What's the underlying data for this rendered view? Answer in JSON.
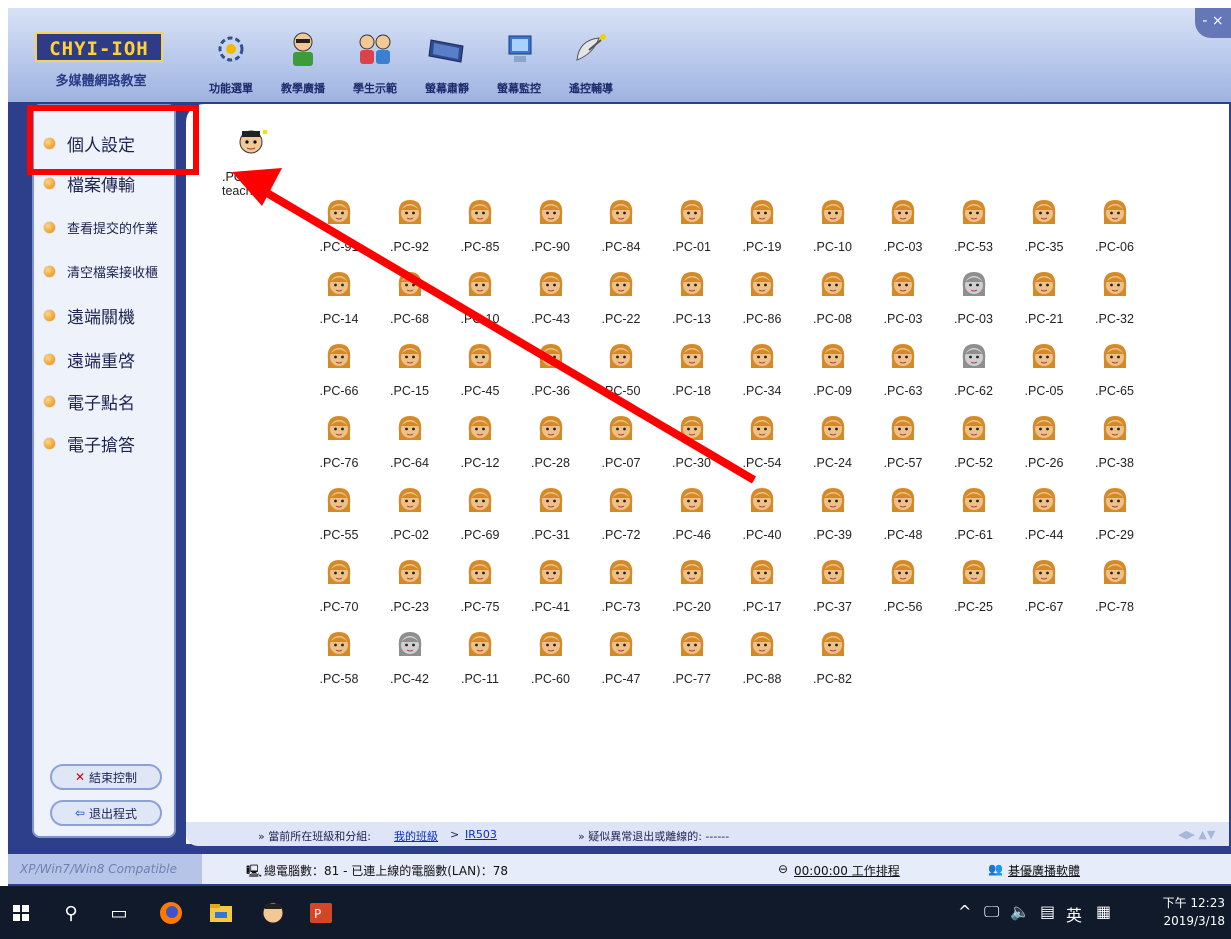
{
  "app": {
    "logo_title": "CHYI-IOH",
    "logo_subtitle": "多媒體網路教室",
    "window_control": "- ×"
  },
  "toolbar": {
    "items": [
      {
        "label": "功能選單",
        "icon": "gear-icon"
      },
      {
        "label": "教學廣播",
        "icon": "teacher-icon"
      },
      {
        "label": "學生示範",
        "icon": "students-icon"
      },
      {
        "label": "螢幕肅靜",
        "icon": "monitor-icon"
      },
      {
        "label": "螢幕監控",
        "icon": "screen-monitor-icon"
      },
      {
        "label": "遙控輔導",
        "icon": "satellite-icon"
      }
    ]
  },
  "sidebar": {
    "items": [
      {
        "label": "個人設定"
      },
      {
        "label": "檔案傳輸"
      },
      {
        "label": "查看提交的作業"
      },
      {
        "label": "清空檔案接收櫃"
      },
      {
        "label": "遠端關機"
      },
      {
        "label": "遠端重啓"
      },
      {
        "label": "電子點名"
      },
      {
        "label": "電子搶答"
      }
    ],
    "end_control": "結束控制",
    "exit_program": "退出程式"
  },
  "teacher": {
    "label": ".PC-teache"
  },
  "computers": [
    {
      "label": ".PC-91",
      "online": true
    },
    {
      "label": ".PC-92",
      "online": true
    },
    {
      "label": ".PC-85",
      "online": true
    },
    {
      "label": ".PC-90",
      "online": true
    },
    {
      "label": ".PC-84",
      "online": true
    },
    {
      "label": ".PC-01",
      "online": true
    },
    {
      "label": ".PC-19",
      "online": true
    },
    {
      "label": ".PC-10",
      "online": true
    },
    {
      "label": ".PC-03",
      "online": true
    },
    {
      "label": ".PC-53",
      "online": true
    },
    {
      "label": ".PC-35",
      "online": true
    },
    {
      "label": ".PC-06",
      "online": true
    },
    {
      "label": ".PC-14",
      "online": true
    },
    {
      "label": ".PC-68",
      "online": true
    },
    {
      "label": ".PC-10",
      "online": true
    },
    {
      "label": ".PC-43",
      "online": true
    },
    {
      "label": ".PC-22",
      "online": true
    },
    {
      "label": ".PC-13",
      "online": true
    },
    {
      "label": ".PC-86",
      "online": true
    },
    {
      "label": ".PC-08",
      "online": true
    },
    {
      "label": ".PC-03",
      "online": true
    },
    {
      "label": ".PC-03",
      "online": false
    },
    {
      "label": ".PC-21",
      "online": true
    },
    {
      "label": ".PC-32",
      "online": true
    },
    {
      "label": ".PC-66",
      "online": true
    },
    {
      "label": ".PC-15",
      "online": true
    },
    {
      "label": ".PC-45",
      "online": true
    },
    {
      "label": ".PC-36",
      "online": true
    },
    {
      "label": ".PC-50",
      "online": true
    },
    {
      "label": ".PC-18",
      "online": true
    },
    {
      "label": ".PC-34",
      "online": true
    },
    {
      "label": ".PC-09",
      "online": true
    },
    {
      "label": ".PC-63",
      "online": true
    },
    {
      "label": ".PC-62",
      "online": false
    },
    {
      "label": ".PC-05",
      "online": true
    },
    {
      "label": ".PC-65",
      "online": true
    },
    {
      "label": ".PC-76",
      "online": true
    },
    {
      "label": ".PC-64",
      "online": true
    },
    {
      "label": ".PC-12",
      "online": true
    },
    {
      "label": ".PC-28",
      "online": true
    },
    {
      "label": ".PC-07",
      "online": true
    },
    {
      "label": ".PC-30",
      "online": true
    },
    {
      "label": ".PC-54",
      "online": true
    },
    {
      "label": ".PC-24",
      "online": true
    },
    {
      "label": ".PC-57",
      "online": true
    },
    {
      "label": ".PC-52",
      "online": true
    },
    {
      "label": ".PC-26",
      "online": true
    },
    {
      "label": ".PC-38",
      "online": true
    },
    {
      "label": ".PC-55",
      "online": true
    },
    {
      "label": ".PC-02",
      "online": true
    },
    {
      "label": ".PC-69",
      "online": true
    },
    {
      "label": ".PC-31",
      "online": true
    },
    {
      "label": ".PC-72",
      "online": true
    },
    {
      "label": ".PC-46",
      "online": true
    },
    {
      "label": ".PC-40",
      "online": true
    },
    {
      "label": ".PC-39",
      "online": true
    },
    {
      "label": ".PC-48",
      "online": true
    },
    {
      "label": ".PC-61",
      "online": true
    },
    {
      "label": ".PC-44",
      "online": true
    },
    {
      "label": ".PC-29",
      "online": true
    },
    {
      "label": ".PC-70",
      "online": true
    },
    {
      "label": ".PC-23",
      "online": true
    },
    {
      "label": ".PC-75",
      "online": true
    },
    {
      "label": ".PC-41",
      "online": true
    },
    {
      "label": ".PC-73",
      "online": true
    },
    {
      "label": ".PC-20",
      "online": true
    },
    {
      "label": ".PC-17",
      "online": true
    },
    {
      "label": ".PC-37",
      "online": true
    },
    {
      "label": ".PC-56",
      "online": true
    },
    {
      "label": ".PC-25",
      "online": true
    },
    {
      "label": ".PC-67",
      "online": true
    },
    {
      "label": ".PC-78",
      "online": true
    },
    {
      "label": ".PC-58",
      "online": true
    },
    {
      "label": ".PC-42",
      "online": false
    },
    {
      "label": ".PC-11",
      "online": true
    },
    {
      "label": ".PC-60",
      "online": true
    },
    {
      "label": ".PC-47",
      "online": true
    },
    {
      "label": ".PC-77",
      "online": true
    },
    {
      "label": ".PC-88",
      "online": true
    },
    {
      "label": ".PC-82",
      "online": true
    }
  ],
  "status": {
    "group_prefix": "» 當前所在班級和分組:",
    "group_link": "我的班級",
    "group_sep": ">",
    "group_room": "IR503",
    "abnormal": "» 疑似異常退出或離線的: ------"
  },
  "bottom": {
    "compat": "XP/Win7/Win8 Compatible",
    "count_text": "總電腦數：81 - 已連上線的電腦數(LAN)：78",
    "schedule": "00:00:00 工作排程",
    "broadcast": "碁優廣播軟體"
  },
  "taskbar": {
    "tray_lang": "英",
    "time": "下午 12:23",
    "date": "2019/3/18"
  },
  "colors": {
    "annotation_red": "#ff0000",
    "frame_blue": "#2d3f8a",
    "online_face": "#e9a64b",
    "offline_face": "#a9a9a9"
  }
}
